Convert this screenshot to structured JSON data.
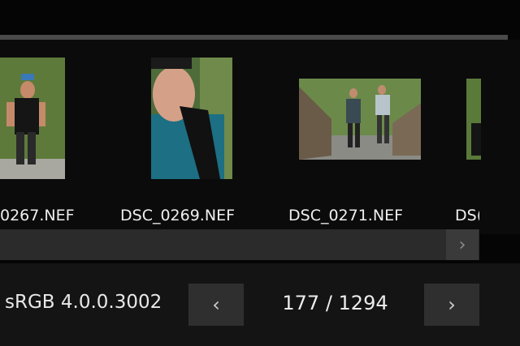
{
  "filmstrip": {
    "items": [
      {
        "filename": "0267.NEF",
        "icon": "photo-runner-trail"
      },
      {
        "filename": "DSC_0269.NEF",
        "icon": "photo-portrait-runner"
      },
      {
        "filename": "DSC_0271.NEF",
        "icon": "photo-two-runners-bridge"
      },
      {
        "filename": "DS(",
        "icon": "photo-partial"
      }
    ],
    "scroll_right_icon": "chevron-right-icon"
  },
  "status_bar": {
    "color_profile": "sRGB 4.0.0.3002",
    "prev_icon": "chevron-left-icon",
    "next_icon": "chevron-right-icon",
    "counter": "177 / 1294"
  },
  "colors": {
    "background": "#050505",
    "scrollbar": "#2b2b2b",
    "button": "#2f2f2f",
    "text": "#e6e6e6"
  }
}
